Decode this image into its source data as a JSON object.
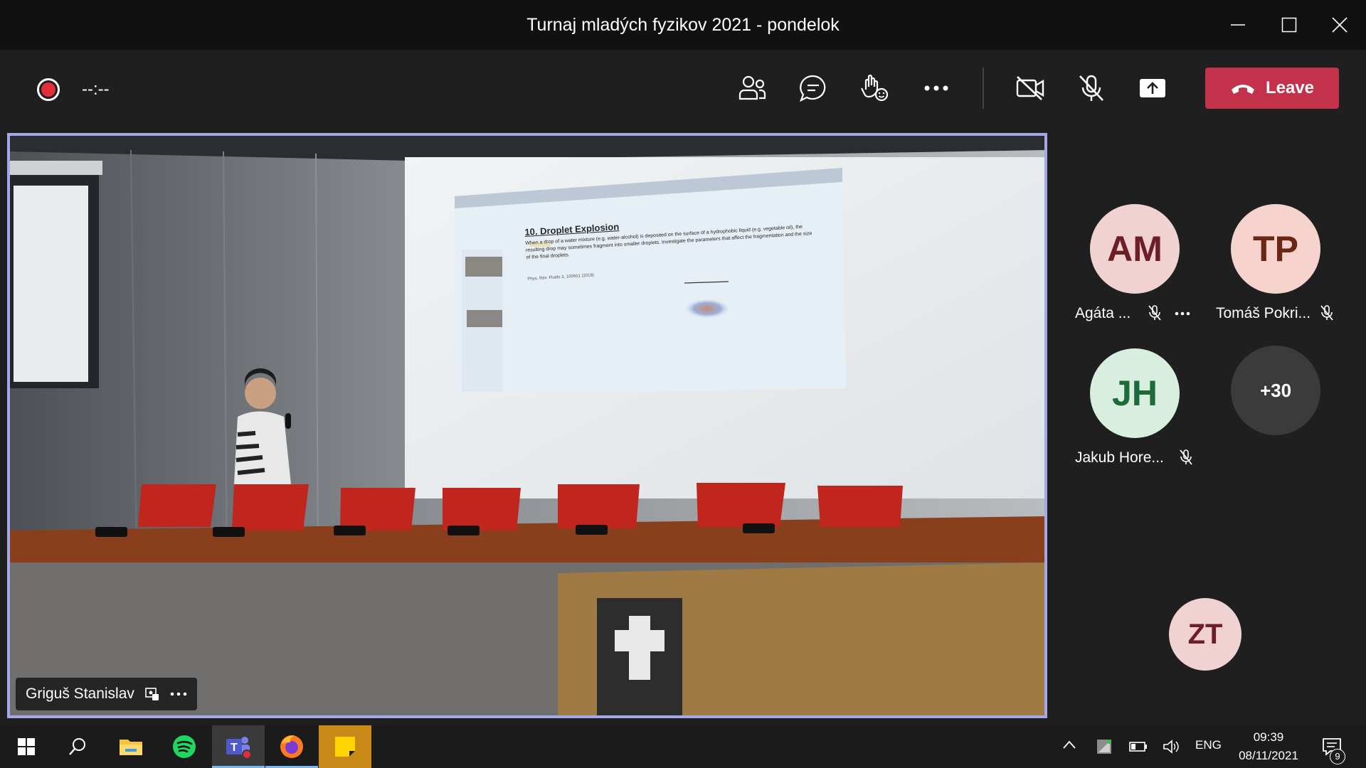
{
  "window": {
    "title": "Turnaj mladých fyzikov 2021 - pondelok",
    "controls": [
      "minimize-icon",
      "maximize-icon",
      "close-icon"
    ]
  },
  "toolbar": {
    "recording_time": "--:--",
    "buttons": [
      "people-icon",
      "chat-icon",
      "reactions-icon",
      "more-options-icon",
      "camera-off-icon",
      "mic-off-icon",
      "share-screen-icon"
    ],
    "leave_label": "Leave"
  },
  "main_video": {
    "speaker_name": "Griguš Stanislav",
    "slide": {
      "heading": "10. Droplet Explosion",
      "body": "When a drop of a water mixture (e.g. water-alcohol) is deposited on the surface of a hydrophobic liquid (e.g. vegetable oil), the resulting drop may sometimes fragment into smaller droplets. Investigate the parameters that affect the fragmentation and the size of the final droplets.",
      "reference": "Phys. Rev. Fluids 3, 100501 (2018)"
    }
  },
  "participants": [
    {
      "initials": "AM",
      "name": "Agáta ...",
      "muted": true,
      "bg": "#f1d2d3",
      "fg": "#6c1f26"
    },
    {
      "initials": "TP",
      "name": "Tomáš Pokri...",
      "muted": true,
      "bg": "#f6d3cc",
      "fg": "#6b2616"
    },
    {
      "initials": "JH",
      "name": "Jakub Hore...",
      "muted": true,
      "bg": "#d8efdf",
      "fg": "#1d6a3a"
    },
    {
      "initials": "+30",
      "name": "",
      "muted": false,
      "bg": "#3b3b3b",
      "fg": "#ffffff"
    }
  ],
  "self_view": {
    "initials": "ZT",
    "bg": "#f1d2d3",
    "fg": "#6c1f26"
  },
  "taskbar": {
    "apps": [
      "windows-start-icon",
      "search-icon",
      "file-explorer-icon",
      "spotify-icon",
      "teams-icon",
      "firefox-icon",
      "sticky-notes-icon"
    ],
    "language": "ENG",
    "time": "09:39",
    "date": "08/11/2021",
    "notification_count": "9"
  },
  "colors": {
    "leave": "#c4314b",
    "active_border": "#a6a7e8",
    "record": "#e02f3b"
  }
}
